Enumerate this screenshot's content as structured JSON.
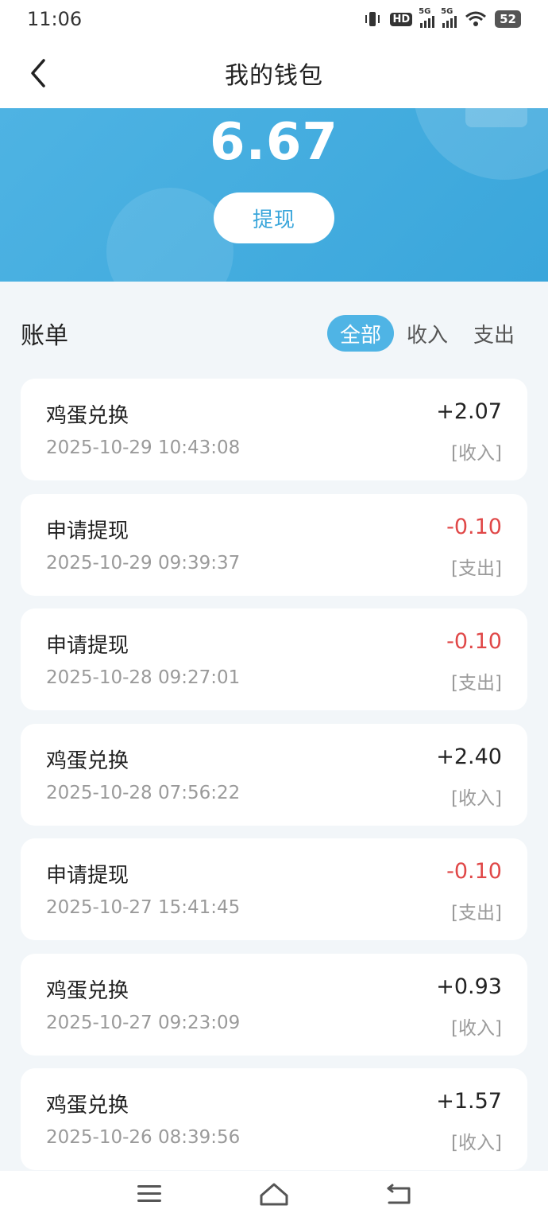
{
  "status_bar": {
    "time": "11:06",
    "network_1": "5G",
    "network_2": "5G",
    "hd_label": "HD",
    "battery": "52"
  },
  "header": {
    "title": "我的钱包"
  },
  "wallet": {
    "balance": "6.67",
    "withdraw_label": "提现"
  },
  "bills": {
    "title": "账单",
    "tabs": [
      {
        "label": "全部",
        "active": true
      },
      {
        "label": "收入",
        "active": false
      },
      {
        "label": "支出",
        "active": false
      }
    ],
    "items": [
      {
        "name": "鸡蛋兑换",
        "time": "2025-10-29 10:43:08",
        "amount": "+2.07",
        "type": "[收入]"
      },
      {
        "name": "申请提现",
        "time": "2025-10-29 09:39:37",
        "amount": "-0.10",
        "type": "[支出]"
      },
      {
        "name": "申请提现",
        "time": "2025-10-28 09:27:01",
        "amount": "-0.10",
        "type": "[支出]"
      },
      {
        "name": "鸡蛋兑换",
        "time": "2025-10-28 07:56:22",
        "amount": "+2.40",
        "type": "[收入]"
      },
      {
        "name": "申请提现",
        "time": "2025-10-27 15:41:45",
        "amount": "-0.10",
        "type": "[支出]"
      },
      {
        "name": "鸡蛋兑换",
        "time": "2025-10-27 09:23:09",
        "amount": "+0.93",
        "type": "[收入]"
      },
      {
        "name": "鸡蛋兑换",
        "time": "2025-10-26 08:39:56",
        "amount": "+1.57",
        "type": "[收入]"
      }
    ]
  },
  "colors": {
    "accent": "#3aa6db",
    "negative": "#e04848",
    "muted": "#9a9a9a",
    "background": "#f2f6f9"
  }
}
